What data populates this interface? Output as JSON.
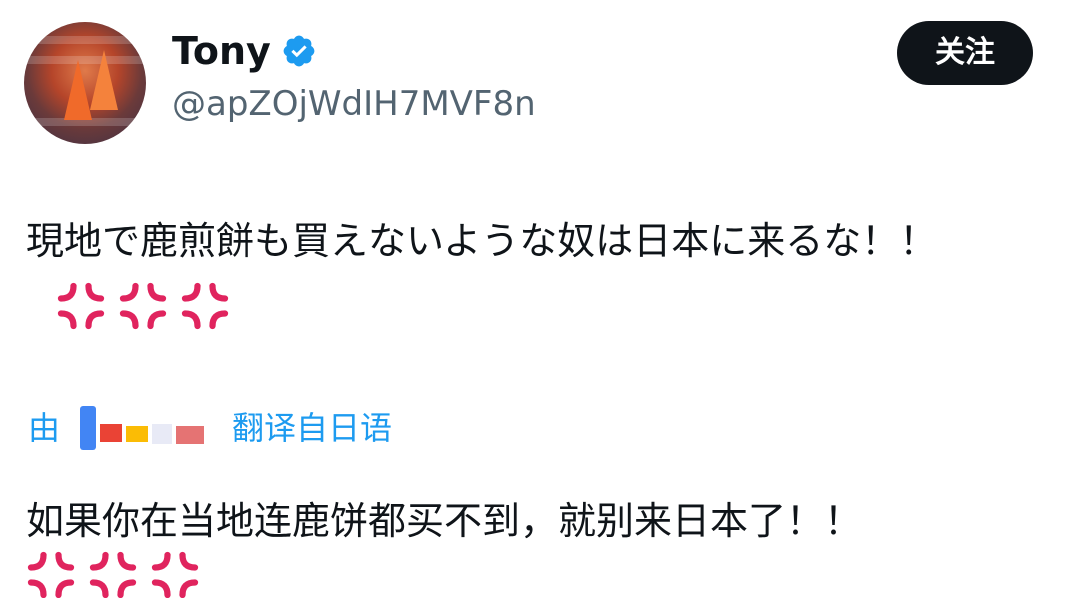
{
  "author": {
    "name": "Tony",
    "handle": "@apZOjWdIH7MVF8n",
    "verified_icon": "verified-badge-icon",
    "avatar_icon": "avatar-image"
  },
  "follow_button": {
    "label": "关注"
  },
  "tweet": {
    "text": "現地で鹿煎餅も買えないような奴は日本に来るな！！",
    "emoji": [
      "anger-symbol",
      "anger-symbol",
      "anger-symbol"
    ]
  },
  "translation_bar": {
    "prefix": "由",
    "provider_icon": "google-logo",
    "suffix": "翻译自日语"
  },
  "translation": {
    "text": "如果你在当地连鹿饼都买不到，就别来日本了！！",
    "emoji": [
      "anger-symbol",
      "anger-symbol",
      "anger-symbol"
    ]
  },
  "colors": {
    "accent_blue": "#1d9bf0",
    "text_primary": "#0f1419",
    "text_secondary": "#536471",
    "button_bg": "#0f1419",
    "anger_red": "#e0245e"
  }
}
